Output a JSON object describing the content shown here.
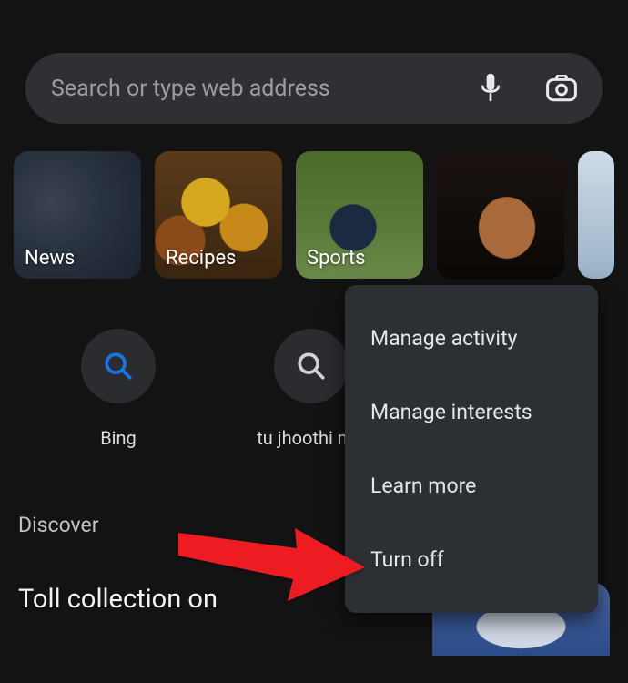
{
  "search": {
    "placeholder": "Search or type web address"
  },
  "tiles": [
    {
      "label": "News"
    },
    {
      "label": "Recipes"
    },
    {
      "label": "Sports"
    },
    {
      "label": ""
    }
  ],
  "shortcuts": [
    {
      "label": "Bing"
    },
    {
      "label": "tu jhoothi m…"
    }
  ],
  "discover": {
    "label": "Discover"
  },
  "feed": {
    "title": "Toll collection on"
  },
  "menu": {
    "items": [
      "Manage activity",
      "Manage interests",
      "Learn more",
      "Turn off"
    ]
  }
}
